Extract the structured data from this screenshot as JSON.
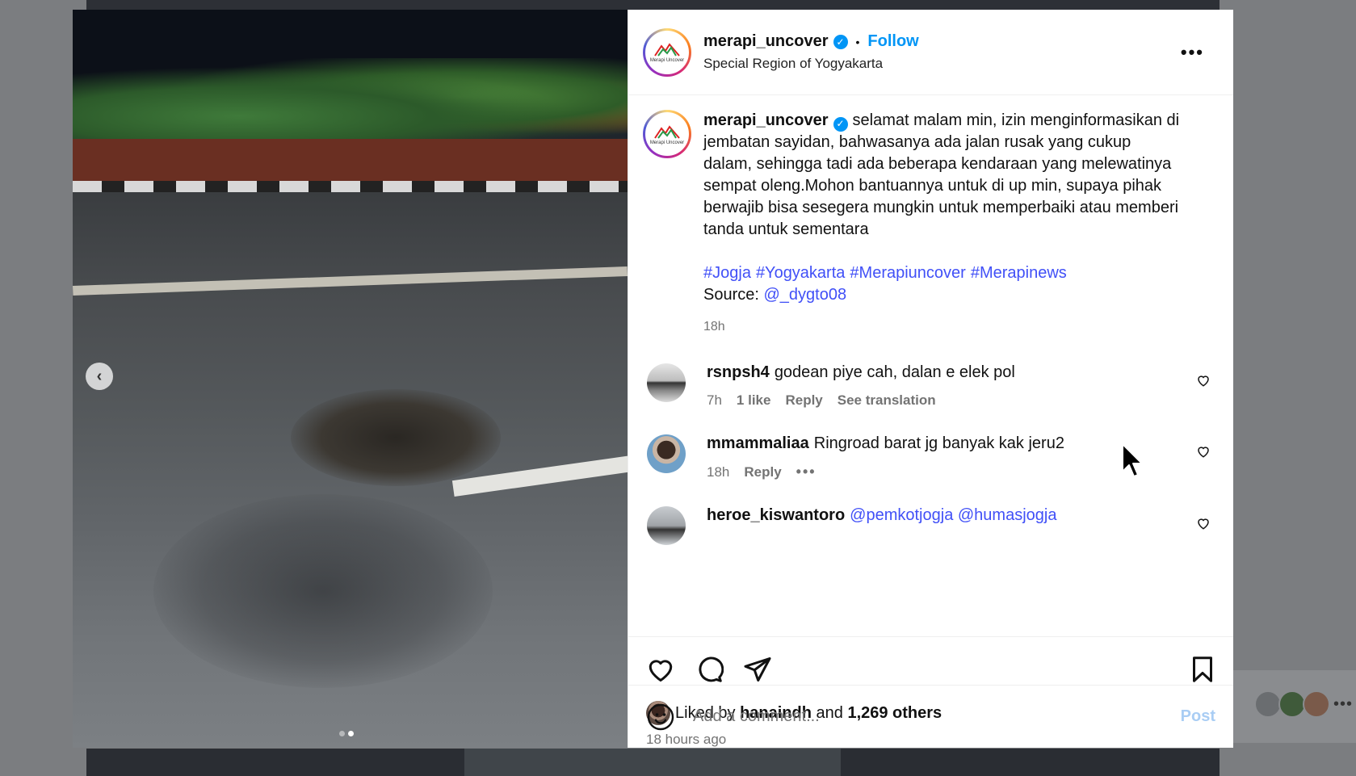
{
  "post": {
    "username": "merapi_uncover",
    "verified": true,
    "follow_label": "Follow",
    "separator": "•",
    "location": "Special Region of Yogyakarta",
    "logo_text": "Merapi Uncover",
    "caption_text": "selamat malam min, izin menginformasikan di jembatan sayidan, bahwasanya ada jalan rusak yang cukup dalam, sehingga tadi ada beberapa kendaraan yang melewatinya sempat oleng.Mohon bantuannya untuk di up min, supaya pihak berwajib bisa sesegera mungkin untuk memperbaiki atau memberi tanda untuk sementara",
    "hashtags": [
      "#Jogja",
      "#Yogyakarta",
      "#Merapiuncover",
      "#Merapinews"
    ],
    "source_label": "Source:",
    "source_mention": "@_dygto08",
    "caption_time": "18h"
  },
  "comments": [
    {
      "username": "rsnpsh4",
      "text": "godean piye cah, dalan e elek pol",
      "time": "7h",
      "likes": "1 like",
      "reply": "Reply",
      "translate": "See translation"
    },
    {
      "username": "mmammaliaa",
      "text": "Ringroad barat jg banyak kak jeru2",
      "time": "18h",
      "reply": "Reply",
      "more": "•••"
    },
    {
      "username": "heroe_kiswantoro",
      "mentions": "@pemkotjogja @humasjogja"
    }
  ],
  "likes": {
    "prefix": "Liked by",
    "first_user": "hanaindh",
    "and": "and",
    "others": "1,269 others"
  },
  "posted_ago": "18 hours ago",
  "add_comment": {
    "placeholder": "Add a comment...",
    "post_label": "Post"
  },
  "media": {
    "prev_arrow": "‹",
    "slide_count": 2,
    "active_slide": 2
  },
  "icons": {
    "more": "•••",
    "check": "✓"
  },
  "colors": {
    "link": "#0095f6",
    "hashtag": "#4150f7",
    "muted": "#737373",
    "post_disabled": "#a9cdf4"
  }
}
